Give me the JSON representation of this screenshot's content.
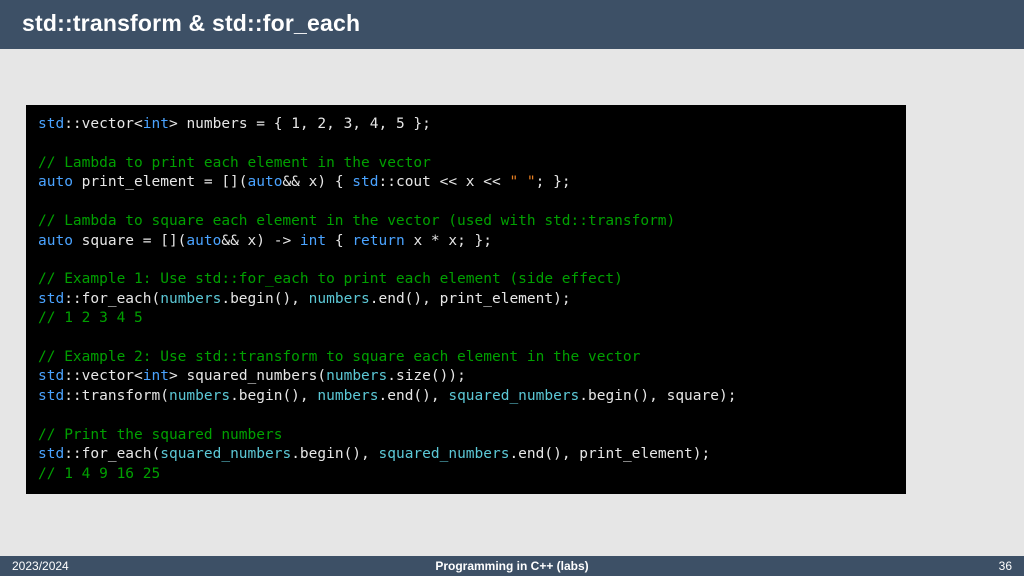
{
  "header": {
    "title": "std::transform & std::for_each"
  },
  "footer": {
    "left": "2023/2024",
    "center": "Programming in C++ (labs)",
    "right": "36"
  },
  "code": {
    "l01_a": "std",
    "l01_b": "::vector<",
    "l01_c": "int",
    "l01_d": "> numbers = { 1, 2, 3, 4, 5 };",
    "l02": "",
    "l03": "// Lambda to print each element in the vector",
    "l04_a": "auto",
    "l04_b": " print_element = [](",
    "l04_c": "auto",
    "l04_d": "&& x) { ",
    "l04_e": "std",
    "l04_f": "::cout << x << ",
    "l04_g": "\" \"",
    "l04_h": "; };",
    "l05": "",
    "l06": "// Lambda to square each element in the vector (used with std::transform)",
    "l07_a": "auto",
    "l07_b": " square = [](",
    "l07_c": "auto",
    "l07_d": "&& x) -> ",
    "l07_e": "int",
    "l07_f": " { ",
    "l07_g": "return",
    "l07_h": " x * x; };",
    "l08": "",
    "l09": "// Example 1: Use std::for_each to print each element (side effect)",
    "l10_a": "std",
    "l10_b": "::for_each(",
    "l10_c": "numbers",
    "l10_d": ".begin(), ",
    "l10_e": "numbers",
    "l10_f": ".end(), print_element);",
    "l11": "// 1 2 3 4 5",
    "l12": "",
    "l13": "// Example 2: Use std::transform to square each element in the vector",
    "l14_a": "std",
    "l14_b": "::vector<",
    "l14_c": "int",
    "l14_d": "> squared_numbers(",
    "l14_e": "numbers",
    "l14_f": ".size());",
    "l15_a": "std",
    "l15_b": "::transform(",
    "l15_c": "numbers",
    "l15_d": ".begin(), ",
    "l15_e": "numbers",
    "l15_f": ".end(), ",
    "l15_g": "squared_numbers",
    "l15_h": ".begin(), square);",
    "l16": "",
    "l17": "// Print the squared numbers",
    "l18_a": "std",
    "l18_b": "::for_each(",
    "l18_c": "squared_numbers",
    "l18_d": ".begin(), ",
    "l18_e": "squared_numbers",
    "l18_f": ".end(), print_element);",
    "l19": "// 1 4 9 16 25"
  }
}
